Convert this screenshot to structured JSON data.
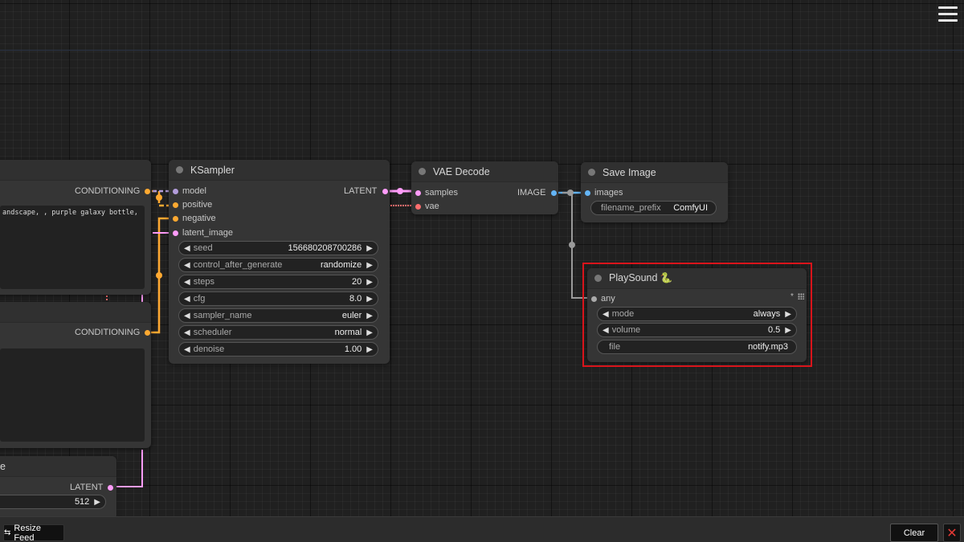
{
  "menu": {
    "icon": "hamburger-menu-icon"
  },
  "nodes": {
    "clip_top": {
      "output_label": "CONDITIONING",
      "prompt_text": "andscape, , purple galaxy bottle,"
    },
    "clip_bottom": {
      "output_label": "CONDITIONING",
      "prompt_text": ""
    },
    "empty_latent": {
      "title_fragment": "e",
      "output_label": "LATENT",
      "width_value": "512"
    },
    "ksampler": {
      "title": "KSampler",
      "inputs": [
        "model",
        "positive",
        "negative",
        "latent_image"
      ],
      "output_label": "LATENT",
      "widgets": [
        {
          "label": "seed",
          "value": "156680208700286"
        },
        {
          "label": "control_after_generate",
          "value": "randomize"
        },
        {
          "label": "steps",
          "value": "20"
        },
        {
          "label": "cfg",
          "value": "8.0"
        },
        {
          "label": "sampler_name",
          "value": "euler"
        },
        {
          "label": "scheduler",
          "value": "normal"
        },
        {
          "label": "denoise",
          "value": "1.00"
        }
      ]
    },
    "vae_decode": {
      "title": "VAE Decode",
      "inputs": [
        "samples",
        "vae"
      ],
      "output_label": "IMAGE"
    },
    "save_image": {
      "title": "Save Image",
      "input": "images",
      "widget_label": "filename_prefix",
      "widget_value": "ComfyUI"
    },
    "playsound": {
      "title": "PlaySound 🐍",
      "input": "any",
      "input_marker": "*",
      "widgets": [
        {
          "label": "mode",
          "value": "always"
        },
        {
          "label": "volume",
          "value": "0.5"
        }
      ],
      "file_label": "file",
      "file_value": "notify.mp3"
    }
  },
  "colors": {
    "conditioning": "#ffa931",
    "latent": "#ff9cf9",
    "image": "#64b5f6",
    "vae": "#ff6e6e",
    "any": "#aaaaaa",
    "highlight": "#d9141b"
  },
  "bottom": {
    "resize_label": "Resize Feed",
    "resize_icon": "resize-arrows-icon",
    "clear_label": "Clear",
    "close_icon": "close-icon"
  }
}
